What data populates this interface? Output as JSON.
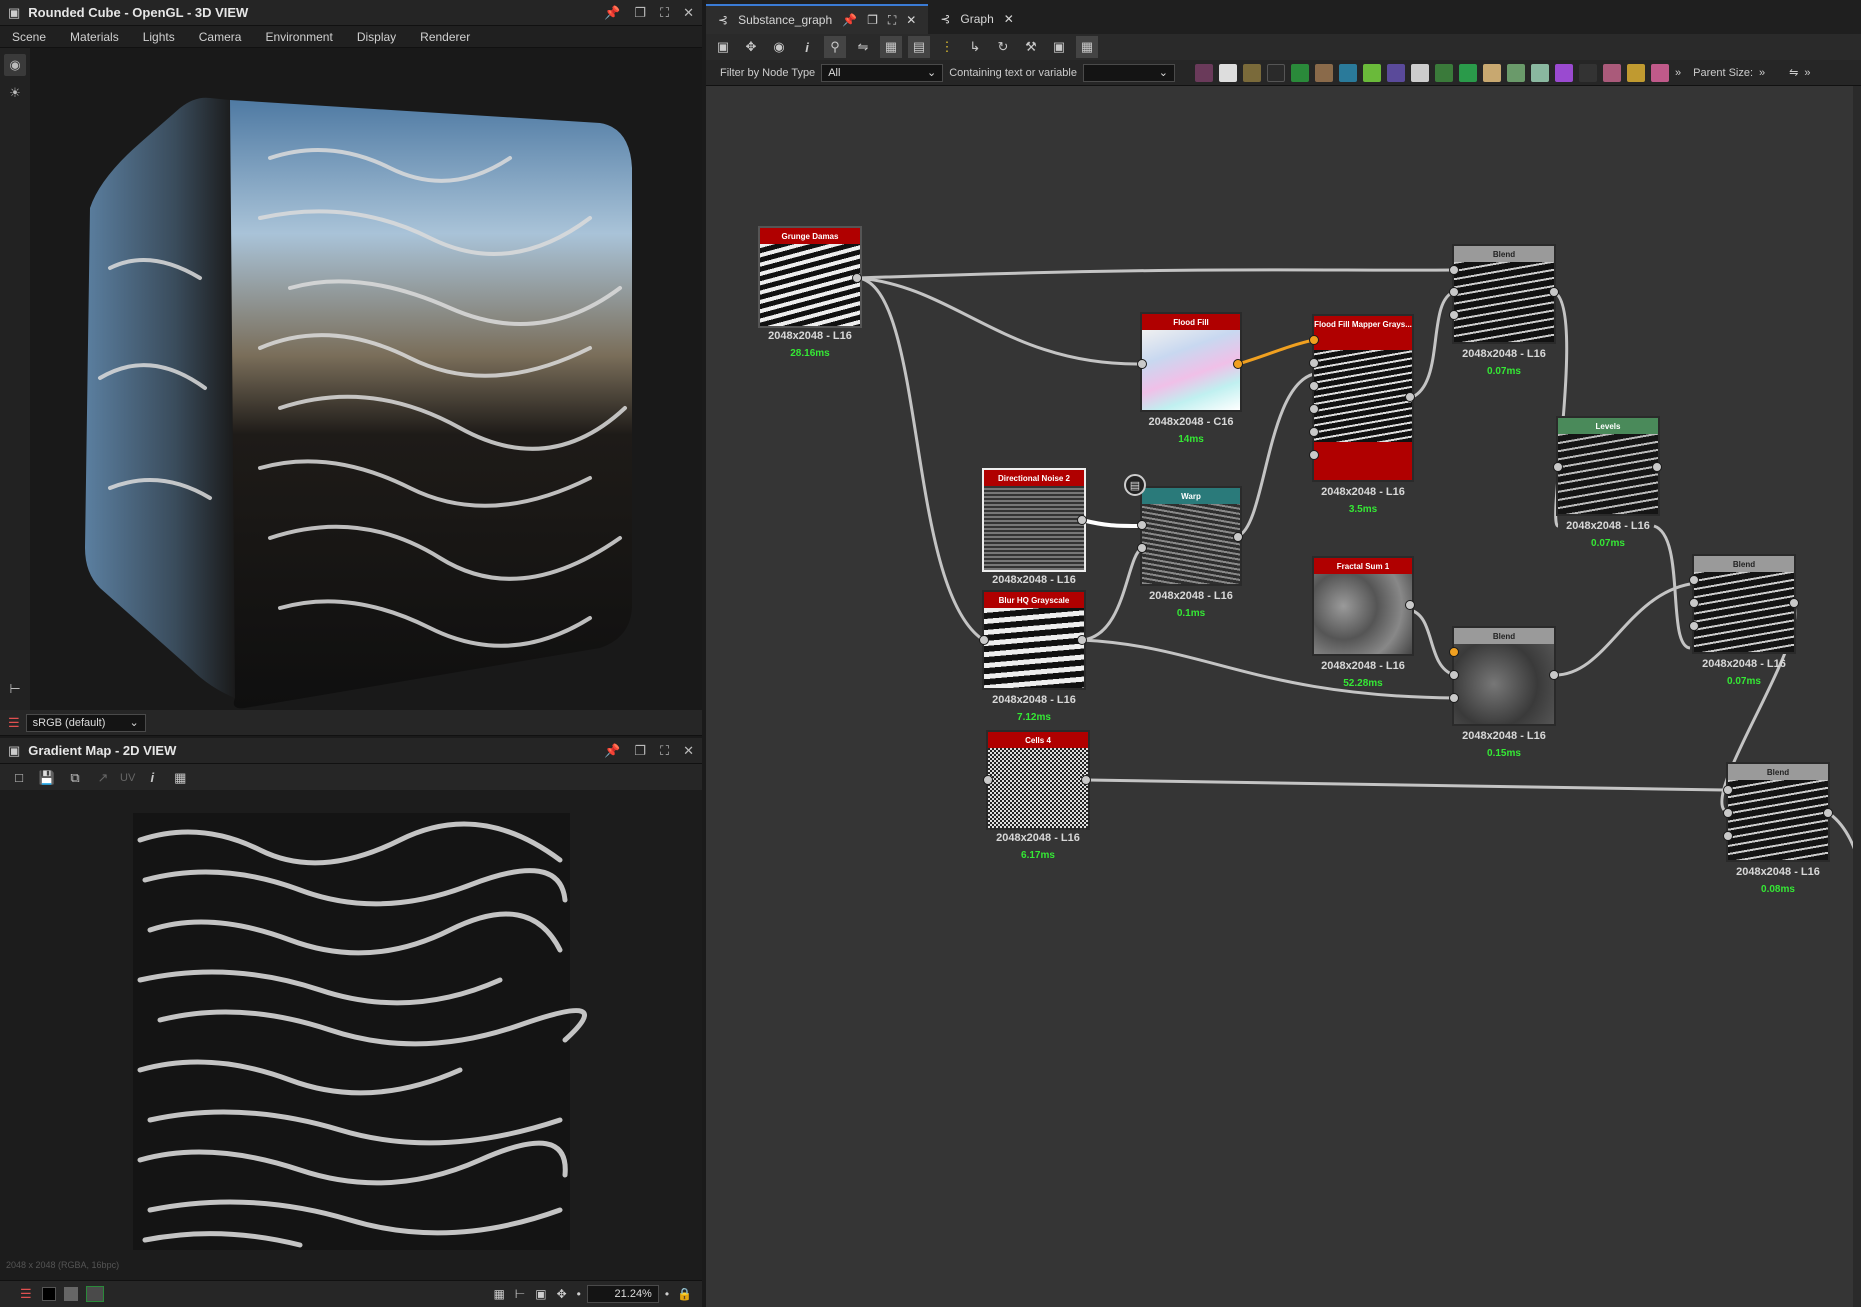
{
  "viewport3d": {
    "title": "Rounded Cube - OpenGL - 3D VIEW",
    "menu": [
      "Scene",
      "Materials",
      "Lights",
      "Camera",
      "Environment",
      "Display",
      "Renderer"
    ],
    "colorspace": "sRGB (default)"
  },
  "viewport2d": {
    "title": "Gradient Map - 2D VIEW",
    "uv_label": "UV",
    "info": "2048 x 2048 (RGBA, 16bpc)",
    "zoom": "21.24%"
  },
  "graph": {
    "tabs": [
      {
        "label": "Substance_graph",
        "active": true
      },
      {
        "label": "Graph",
        "active": false
      }
    ],
    "filter_label": "Filter by Node Type",
    "filter_value": "All",
    "contains_label": "Containing text or variable",
    "contains_value": "",
    "parent_size_label": "Parent Size:",
    "nodes": [
      {
        "id": "grunge",
        "title": "Grunge Damas",
        "size": "2048x2048 - L16",
        "time": "28.16ms",
        "header": "#b00000"
      },
      {
        "id": "floodfill",
        "title": "Flood Fill",
        "size": "2048x2048 - C16",
        "time": "14ms",
        "header": "#b00000"
      },
      {
        "id": "ffmapper",
        "title": "Flood Fill Mapper Grays...",
        "size": "2048x2048 - L16",
        "time": "3.5ms",
        "header": "#b00000"
      },
      {
        "id": "blend1",
        "title": "Blend",
        "size": "2048x2048 - L16",
        "time": "0.07ms",
        "header": "#9a9a9a"
      },
      {
        "id": "levels",
        "title": "Levels",
        "size": "2048x2048 - L16",
        "time": "0.07ms",
        "header": "#4a8a5a"
      },
      {
        "id": "dirnoise",
        "title": "Directional Noise 2",
        "size": "2048x2048 - L16",
        "time": "",
        "header": "#b00000"
      },
      {
        "id": "warp",
        "title": "Warp",
        "size": "2048x2048 - L16",
        "time": "0.1ms",
        "header": "#2a7a7a"
      },
      {
        "id": "blurhq",
        "title": "Blur HQ Grayscale",
        "size": "2048x2048 - L16",
        "time": "7.12ms",
        "header": "#b00000"
      },
      {
        "id": "fractal",
        "title": "Fractal Sum 1",
        "size": "2048x2048 - L16",
        "time": "52.28ms",
        "header": "#b00000"
      },
      {
        "id": "blend2",
        "title": "Blend",
        "size": "2048x2048 - L16",
        "time": "0.15ms",
        "header": "#9a9a9a"
      },
      {
        "id": "blend3",
        "title": "Blend",
        "size": "2048x2048 - L16",
        "time": "0.07ms",
        "header": "#9a9a9a"
      },
      {
        "id": "cells",
        "title": "Cells 4",
        "size": "2048x2048 - L16",
        "time": "6.17ms",
        "header": "#b00000"
      },
      {
        "id": "blend4",
        "title": "Blend",
        "size": "2048x2048 - L16",
        "time": "0.08ms",
        "header": "#9a9a9a"
      }
    ]
  },
  "colors": {
    "node_generator": "#b00000",
    "node_blend": "#9a9a9a",
    "node_levels": "#4a8a5a",
    "node_warp": "#2a7a7a",
    "timing_text": "#35e835",
    "accent": "#3a7bd5"
  }
}
